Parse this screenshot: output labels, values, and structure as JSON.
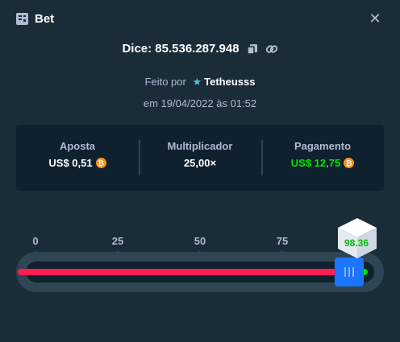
{
  "header": {
    "title": "Bet",
    "close_icon": "close-icon"
  },
  "game": {
    "label": "Dice: 85.536.287.948",
    "icons": [
      "copy-icon",
      "link-icon"
    ]
  },
  "made_by": {
    "prefix": "Feito por",
    "user": "Tetheusss",
    "user_icon": "star-badge-icon"
  },
  "date": "em 19/04/2022 às 01:52",
  "stats": {
    "bet": {
      "label": "Aposta",
      "value": "US$ 0,51"
    },
    "multiplier": {
      "label": "Multiplicador",
      "value": "25,00×"
    },
    "payout": {
      "label": "Pagamento",
      "value": "US$ 12,75"
    },
    "coin_glyph": "₿"
  },
  "slider": {
    "ticks": [
      "0",
      "25",
      "50",
      "75"
    ],
    "target": 96.0,
    "result": "98.36",
    "colors": {
      "lose": "#ff1e52",
      "win": "#00e701",
      "handle": "#1a75ff"
    }
  }
}
